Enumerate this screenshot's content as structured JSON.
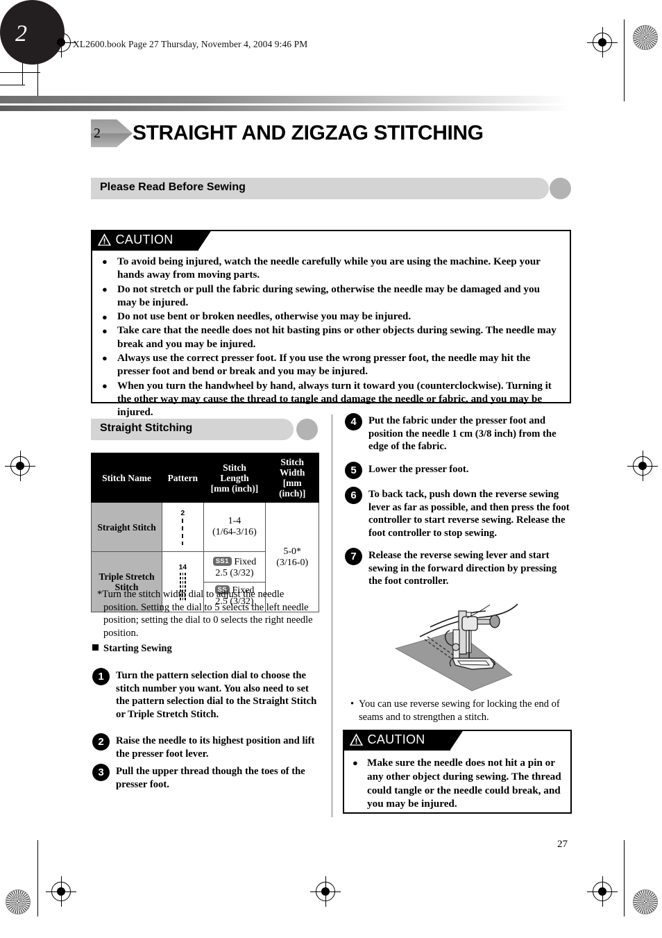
{
  "page": {
    "file_header": "XL2600.book  Page 27  Thursday, November 4, 2004  9:46 PM",
    "page_number": "27",
    "chapter_number": "2",
    "chapter_tab_number": "2",
    "chapter_title": "STRAIGHT AND ZIGZAG STITCHING"
  },
  "sections": {
    "read_before_sewing": "Please Read Before Sewing",
    "straight_stitching": "Straight Stitching",
    "starting_sewing": "Starting Sewing"
  },
  "caution_top": {
    "label": "CAUTION",
    "icon": "warning-triangle-icon",
    "items": [
      "To avoid being injured, watch the needle carefully while you are using the machine. Keep your hands away from moving parts.",
      "Do not stretch or pull the fabric during sewing, otherwise the needle may be damaged and you may be injured.",
      "Do not use bent or broken needles, otherwise you may be injured.",
      "Take care that the needle does not hit basting pins or other objects during sewing. The needle may break and you may be injured.",
      "Always use the correct presser foot. If you use the wrong presser foot, the needle may hit the presser foot and bend or break and you may be injured.",
      "When you turn the handwheel by hand, always turn it toward you (counterclockwise). Turning it the other way may cause the thread to tangle and damage the needle or fabric, and you may be injured."
    ]
  },
  "caution_bottom": {
    "label": "CAUTION",
    "icon": "warning-triangle-icon",
    "items": [
      "Make sure the needle does not hit a pin or any other object during sewing. The thread could tangle or the needle could break, and you may be injured."
    ]
  },
  "table": {
    "headers": {
      "name": "Stitch Name",
      "pattern": "Pattern",
      "length_l1": "Stitch",
      "length_l2": "Length",
      "length_l3": "[mm (inch)]",
      "width_l1": "Stitch",
      "width_l2": "Width",
      "width_l3": "[mm (inch)]"
    },
    "rows": [
      {
        "name": "Straight Stitch",
        "pattern_number": "2",
        "pattern_type": "dashed-line",
        "length_l1": "1-4",
        "length_l2": "(1/64-3/16)"
      },
      {
        "name_l1": "Triple Stretch",
        "name_l2": "Stitch",
        "pattern_number": "14",
        "pattern_type": "triple-line",
        "length_rows": [
          {
            "badge": "SS1",
            "label": "Fixed",
            "value": "2.5 (3/32)"
          },
          {
            "badge": "SS",
            "label": "Fixed",
            "value": "2.5 (3/32)"
          }
        ]
      }
    ],
    "width_l1": "5-0*",
    "width_l2": "(3/16-0)"
  },
  "footnote": "*Turn the stitch width dial to adjust the needle position. Setting the dial to 5 selects the left needle position; setting the dial to 0 selects the right needle position.",
  "steps_left": [
    {
      "num": "1",
      "text": "Turn the pattern selection dial to choose the stitch number you want. You also need to set the pattern selection dial to the Straight Stitch or Triple Stretch Stitch."
    },
    {
      "num": "2",
      "text": "Raise the needle to its highest position and lift the presser foot lever."
    },
    {
      "num": "3",
      "text": "Pull the upper thread though the toes of the presser foot."
    }
  ],
  "steps_right": [
    {
      "num": "4",
      "text": "Put the fabric under the presser foot and position the needle 1 cm (3/8 inch) from the edge of the fabric."
    },
    {
      "num": "5",
      "text": "Lower the presser foot."
    },
    {
      "num": "6",
      "text": "To back tack, push down the reverse sewing lever as far as possible, and then press the foot controller to start reverse sewing. Release the foot controller to stop sewing."
    },
    {
      "num": "7",
      "text": "Release the reverse sewing lever and start sewing in the forward direction by pressing the foot controller."
    }
  ],
  "illustration_note": "You can use reverse sewing for locking the end of seams and to strengthen a stitch.",
  "illustration_name": "presser-foot-on-fabric-illustration",
  "colors": {
    "banner_bar": "#d4d4d4",
    "banner_cap": "#b3b3b3",
    "table_header_bg": "#000000",
    "table_name_bg": "#b6b6b6",
    "badge_bg": "#6a6a6a",
    "fabric": "#9a9a9a",
    "chapter_tab": "#231f20"
  }
}
